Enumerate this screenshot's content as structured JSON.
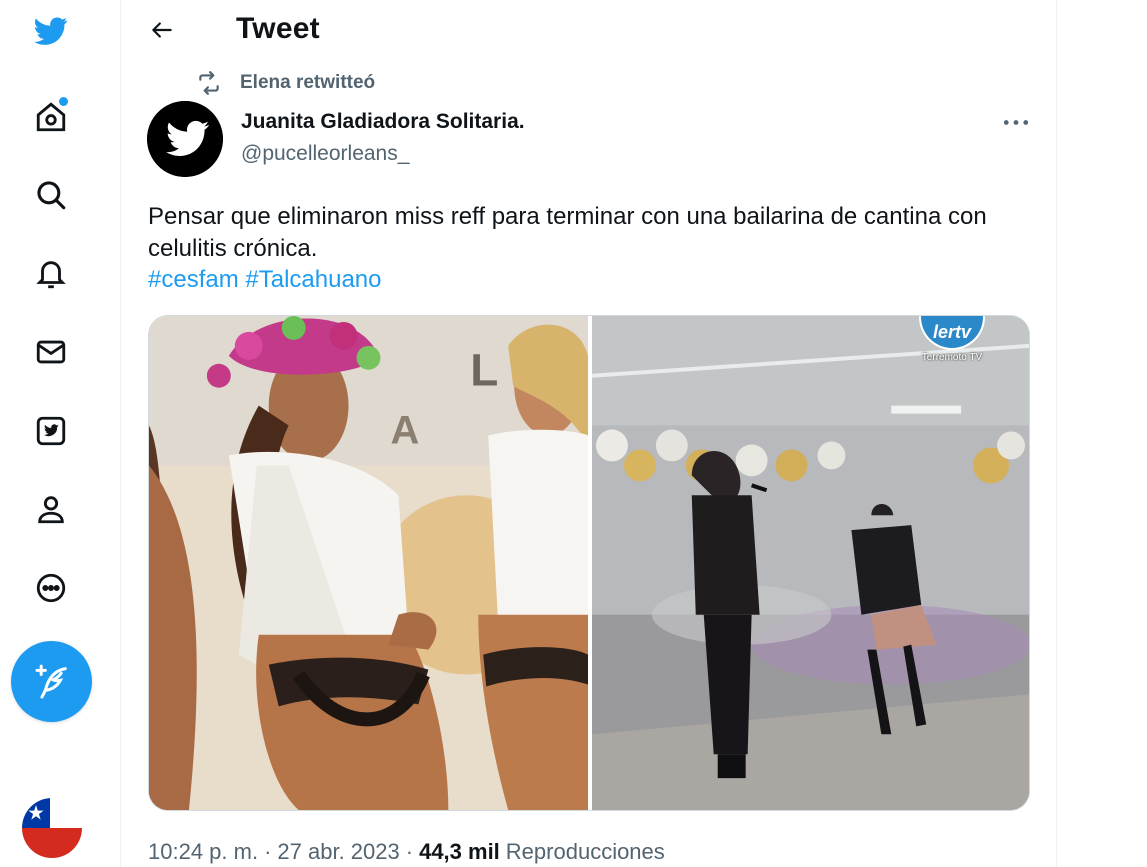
{
  "header": {
    "title": "Tweet"
  },
  "nav": {
    "items": [
      "twitter-logo",
      "home",
      "explore",
      "notifications",
      "messages",
      "twitter-blue",
      "profile",
      "more"
    ],
    "compose": "compose-tweet",
    "region": "chile-flag"
  },
  "retweet": {
    "text": "Elena retwitteó"
  },
  "author": {
    "name": "Juanita Gladiadora Solitaria.",
    "handle": "@pucelleorleans_"
  },
  "tweet": {
    "text": "Pensar que eliminaron miss reff para terminar con una bailarina de cantina con celulitis crónica.",
    "hashtags": [
      "#cesfam",
      "#Talcahuano"
    ]
  },
  "media": {
    "watermark": {
      "logo_text": "lertv",
      "label": "Terremoto TV"
    }
  },
  "meta": {
    "time": "10:24 p. m.",
    "separator": "·",
    "date": "27 abr. 2023",
    "views_count": "44,3 mil",
    "views_label": "Reproducciones"
  },
  "colors": {
    "accent": "#1d9bf0",
    "secondary_text": "#536471",
    "primary_text": "#0f1419"
  }
}
